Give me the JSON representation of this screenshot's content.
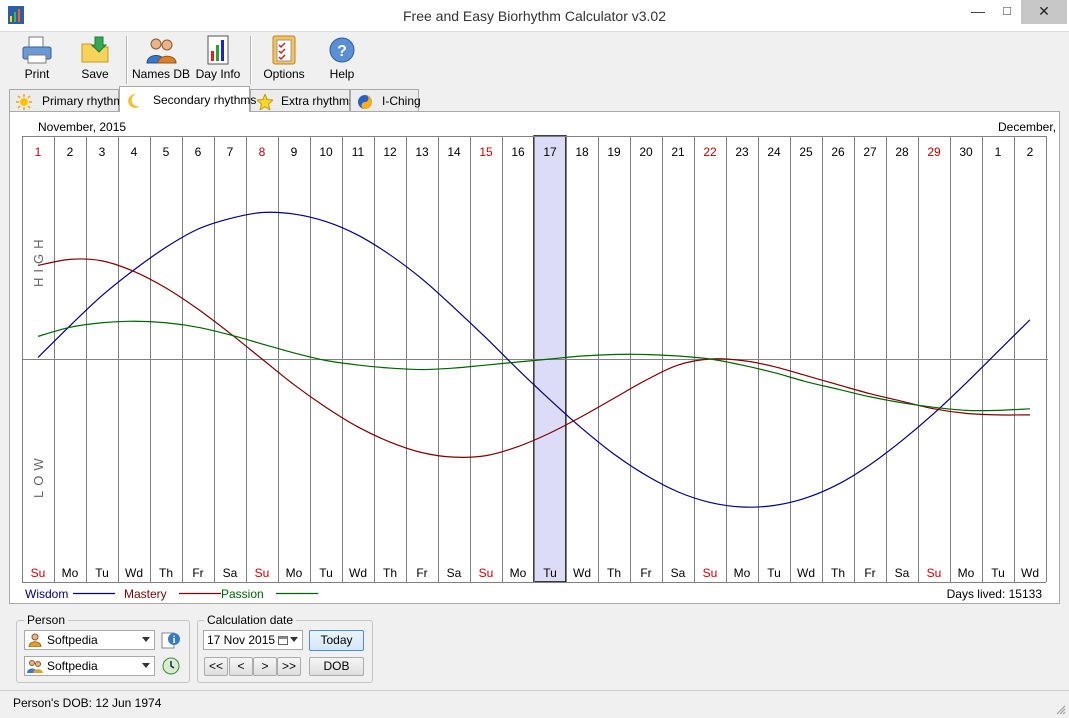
{
  "window": {
    "title": "Free and Easy Biorhythm Calculator v3.02"
  },
  "toolbar": [
    {
      "label": "Print",
      "icon": "printer-icon"
    },
    {
      "label": "Save",
      "icon": "folder-save-icon"
    },
    {
      "label": "Names DB",
      "icon": "people-icon"
    },
    {
      "label": "Day Info",
      "icon": "chart-document-icon"
    },
    {
      "label": "Options",
      "icon": "checklist-icon"
    },
    {
      "label": "Help",
      "icon": "help-icon"
    }
  ],
  "tabs": [
    {
      "label": "Primary rhythms",
      "icon": "sun-icon"
    },
    {
      "label": "Secondary rhythms",
      "icon": "moon-icon",
      "active": true
    },
    {
      "label": "Extra rhythms",
      "icon": "star-icon"
    },
    {
      "label": "I-Ching",
      "icon": "yin-yang-icon"
    }
  ],
  "chart_data": {
    "type": "line",
    "month_left": "November, 2015",
    "month_right": "December, 2",
    "days": [
      "1",
      "2",
      "3",
      "4",
      "5",
      "6",
      "7",
      "8",
      "9",
      "10",
      "11",
      "12",
      "13",
      "14",
      "15",
      "16",
      "17",
      "18",
      "19",
      "20",
      "21",
      "22",
      "23",
      "24",
      "25",
      "26",
      "27",
      "28",
      "29",
      "30",
      "1",
      "2"
    ],
    "weekdays": [
      "Su",
      "Mo",
      "Tu",
      "Wd",
      "Th",
      "Fr",
      "Sa",
      "Su",
      "Mo",
      "Tu",
      "Wd",
      "Th",
      "Fr",
      "Sa",
      "Su",
      "Mo",
      "Tu",
      "Wd",
      "Th",
      "Fr",
      "Sa",
      "Su",
      "Mo",
      "Tu",
      "Wd",
      "Th",
      "Fr",
      "Sa",
      "Su",
      "Mo",
      "Tu",
      "Wd"
    ],
    "highlighted_day": "17",
    "sunday_color": "#cc0000",
    "high_label": "HIGH",
    "low_label": "LOW",
    "ylim": [
      -100,
      100
    ],
    "series": [
      {
        "name": "Wisdom",
        "color": "#000080",
        "values": [
          1,
          22,
          42,
          59,
          74,
          86,
          93,
          97,
          96,
          91,
          82,
          69,
          53,
          34,
          14,
          -7,
          -27,
          -46,
          -63,
          -77,
          -88,
          -95,
          -98,
          -97,
          -92,
          -83,
          -70,
          -54,
          -36,
          -16,
          5,
          26
        ]
      },
      {
        "name": "Mastery",
        "color": "#800000",
        "values": [
          62,
          66,
          65,
          58,
          47,
          33,
          17,
          0,
          -17,
          -32,
          -45,
          -55,
          -62,
          -65,
          -64,
          -58,
          -49,
          -38,
          -26,
          -14,
          -4,
          0,
          -1,
          -5,
          -11,
          -17,
          -23,
          -28,
          -33,
          -36,
          -37,
          -37
        ]
      },
      {
        "name": "Passion",
        "color": "#006400",
        "values": [
          15,
          21,
          24,
          25,
          24,
          21,
          16,
          10,
          4,
          -1,
          -4,
          -6,
          -7,
          -6,
          -4,
          -2,
          0,
          2,
          3,
          3,
          2,
          0,
          -4,
          -9,
          -15,
          -20,
          -25,
          -29,
          -32,
          -34,
          -34,
          -33
        ]
      }
    ],
    "days_lived_label": "Days lived:",
    "days_lived": "15133"
  },
  "person": {
    "group_label": "Person",
    "primary": "Softpedia",
    "secondary": "Softpedia"
  },
  "calc": {
    "group_label": "Calculation date",
    "date": "17 Nov 2015",
    "today": "Today",
    "dob": "DOB",
    "nav": [
      "<<",
      "<",
      ">",
      ">>"
    ]
  },
  "status": {
    "dob_text": "Person's DOB: 12 Jun 1974"
  }
}
